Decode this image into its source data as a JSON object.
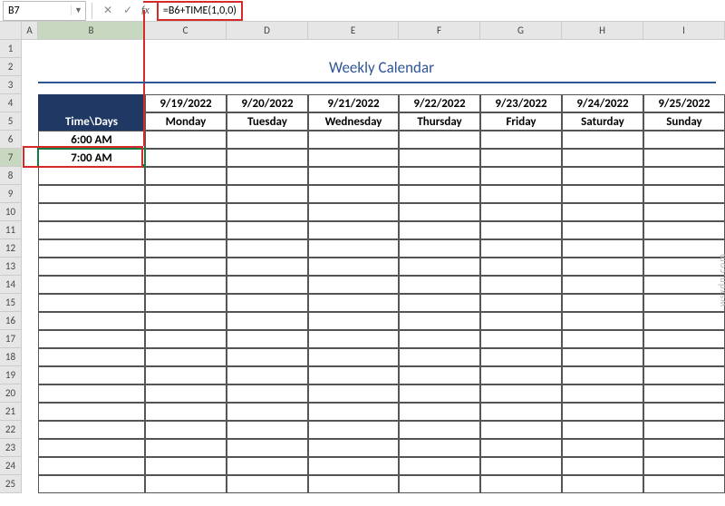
{
  "cellRef": "B7",
  "formula": "=B6+TIME(1,0,0)",
  "title": "Weekly Calendar",
  "columns": [
    "A",
    "B",
    "C",
    "D",
    "E",
    "F",
    "G",
    "H",
    "I"
  ],
  "rows": [
    "1",
    "2",
    "3",
    "4",
    "5",
    "6",
    "7",
    "8",
    "9",
    "10",
    "11",
    "12",
    "13",
    "14",
    "15",
    "16",
    "17",
    "18",
    "19",
    "20",
    "21",
    "22",
    "23",
    "24",
    "25"
  ],
  "timeDaysLabel": "Time\\Days",
  "dates": [
    "9/19/2022",
    "9/20/2022",
    "9/21/2022",
    "9/22/2022",
    "9/23/2022",
    "9/24/2022",
    "9/25/2022"
  ],
  "days": [
    "Monday",
    "Tuesday",
    "Wednesday",
    "Thursday",
    "Friday",
    "Saturday",
    "Sunday"
  ],
  "times": [
    "6:00 AM",
    "7:00 AM"
  ],
  "watermark": "wsxdn.com"
}
